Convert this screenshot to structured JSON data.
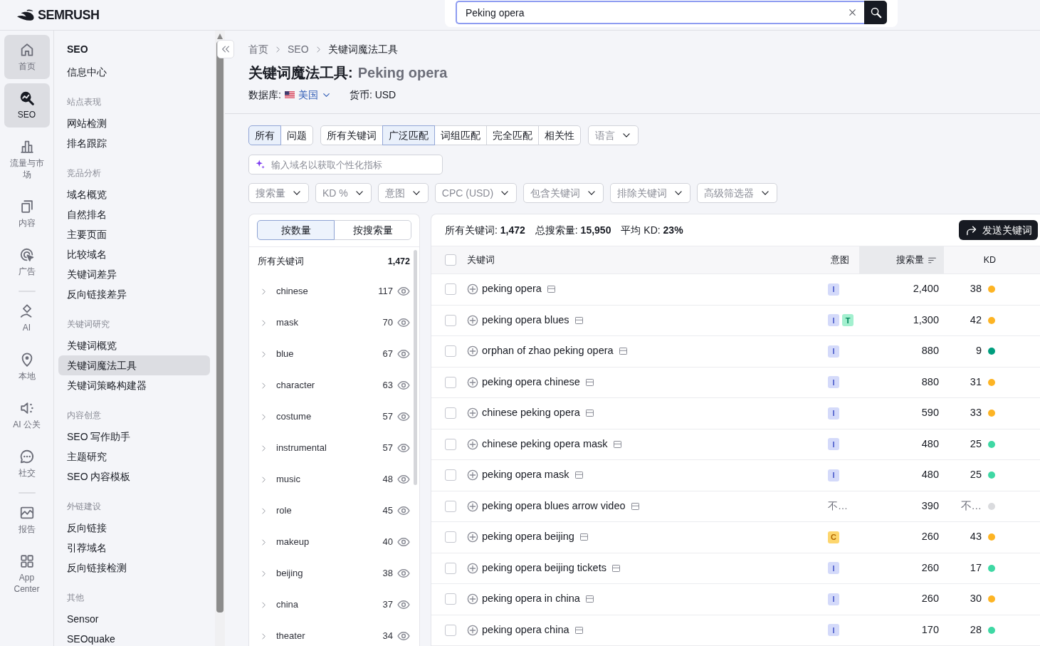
{
  "logo": {
    "text": "SEMRUSH"
  },
  "search": {
    "value": "Peking opera"
  },
  "rail": {
    "groups": [
      [
        {
          "label": "首页",
          "selected": false,
          "highlighted": true
        },
        {
          "label": "SEO",
          "selected": true,
          "highlighted": false
        },
        {
          "label": "流量与市场",
          "selected": false,
          "highlighted": false
        },
        {
          "label": "内容",
          "selected": false,
          "highlighted": false
        },
        {
          "label": "广告",
          "selected": false,
          "highlighted": false
        }
      ],
      [
        {
          "label": "AI",
          "selected": false,
          "highlighted": false
        },
        {
          "label": "本地",
          "selected": false,
          "highlighted": false
        },
        {
          "label": "AI 公关",
          "selected": false,
          "highlighted": false
        },
        {
          "label": "社交",
          "selected": false,
          "highlighted": false
        }
      ],
      [
        {
          "label": "报告",
          "selected": false,
          "highlighted": false
        },
        {
          "label": "App Center",
          "selected": false,
          "highlighted": false
        }
      ]
    ]
  },
  "menu": {
    "title": "SEO",
    "items": [
      {
        "label": "信息中心",
        "selected": false
      }
    ],
    "sections": [
      {
        "heading": "站点表现",
        "items": [
          {
            "label": "网站检测",
            "selected": false
          },
          {
            "label": "排名跟踪",
            "selected": false
          }
        ]
      },
      {
        "heading": "竞品分析",
        "items": [
          {
            "label": "域名概览",
            "selected": false
          },
          {
            "label": "自然排名",
            "selected": false
          },
          {
            "label": "主要页面",
            "selected": false
          },
          {
            "label": "比较域名",
            "selected": false
          },
          {
            "label": "关键词差异",
            "selected": false
          },
          {
            "label": "反向链接差异",
            "selected": false
          }
        ]
      },
      {
        "heading": "关键词研究",
        "items": [
          {
            "label": "关键词概览",
            "selected": false
          },
          {
            "label": "关键词魔法工具",
            "selected": true
          },
          {
            "label": "关键词策略构建器",
            "selected": false
          }
        ]
      },
      {
        "heading": "内容创意",
        "items": [
          {
            "label": "SEO 写作助手",
            "selected": false
          },
          {
            "label": "主题研究",
            "selected": false
          },
          {
            "label": "SEO 内容模板",
            "selected": false
          }
        ]
      },
      {
        "heading": "外链建设",
        "items": [
          {
            "label": "反向链接",
            "selected": false
          },
          {
            "label": "引荐域名",
            "selected": false
          },
          {
            "label": "反向链接检测",
            "selected": false
          }
        ]
      },
      {
        "heading": "其他",
        "items": [
          {
            "label": "Sensor",
            "selected": false
          },
          {
            "label": "SEOquake",
            "selected": false
          }
        ]
      }
    ]
  },
  "breadcrumbs": [
    {
      "label": "首页"
    },
    {
      "label": "SEO"
    },
    {
      "label": "关键词魔法工具"
    }
  ],
  "title": {
    "tool": "关键词魔法工具:",
    "query": "Peking opera"
  },
  "database": {
    "label": "数据库:",
    "value": "美国"
  },
  "currency": "货币: USD",
  "match_filters": [
    [
      {
        "label": "所有",
        "selected": true
      },
      {
        "label": "问题",
        "selected": false
      }
    ],
    [
      {
        "label": "所有关键词",
        "selected": false
      },
      {
        "label": "广泛匹配",
        "selected": true
      },
      {
        "label": "词组匹配",
        "selected": false
      },
      {
        "label": "完全匹配",
        "selected": false
      },
      {
        "label": "相关性",
        "selected": false
      }
    ]
  ],
  "language": {
    "placeholder": "语言"
  },
  "domain_input": {
    "placeholder": "输入域名以获取个性化指标"
  },
  "filters": [
    "搜索量",
    "KD %",
    "意图",
    "CPC (USD)",
    "包含关键词",
    "排除关键词",
    "高级筛选器"
  ],
  "groups_panel": {
    "toggle": [
      {
        "label": "按数量",
        "selected": true
      },
      {
        "label": "按搜索量",
        "selected": false
      }
    ],
    "total": {
      "label": "所有关键词",
      "count": "1,472"
    },
    "items": [
      {
        "label": "chinese",
        "count": "117",
        "expanded": false
      },
      {
        "label": "mask",
        "count": "70",
        "expanded": false
      },
      {
        "label": "blue",
        "count": "67",
        "expanded": false
      },
      {
        "label": "character",
        "count": "63",
        "expanded": false
      },
      {
        "label": "costume",
        "count": "57",
        "expanded": false
      },
      {
        "label": "instrumental",
        "count": "57",
        "expanded": false
      },
      {
        "label": "music",
        "count": "48",
        "expanded": false
      },
      {
        "label": "role",
        "count": "45",
        "expanded": false
      },
      {
        "label": "makeup",
        "count": "40",
        "expanded": false
      },
      {
        "label": "beijing",
        "count": "38",
        "expanded": false
      },
      {
        "label": "china",
        "count": "37",
        "expanded": false
      },
      {
        "label": "theater",
        "count": "34",
        "expanded": false
      }
    ]
  },
  "results": {
    "stats": [
      "所有关键词: **1,472**",
      "总搜索量: **15,950**",
      "平均 KD: **23%**"
    ],
    "send_button": "发送关键词",
    "select_all_checked": false,
    "columns": [
      {
        "label": "关键词",
        "sorted": false
      },
      {
        "label": "意图",
        "sorted": false
      },
      {
        "label": "搜索量",
        "sorted": true
      },
      {
        "label": "KD",
        "sorted": false
      }
    ],
    "rows": [
      {
        "keyword": "peking opera",
        "checked": false,
        "intents": [
          {
            "label": "I",
            "kind": "informational"
          }
        ],
        "volume": "2,400",
        "kd": {
          "value": "38",
          "color": "#fdb424"
        }
      },
      {
        "keyword": "peking opera blues",
        "checked": false,
        "intents": [
          {
            "label": "I",
            "kind": "informational"
          },
          {
            "label": "T",
            "kind": "transactional"
          }
        ],
        "volume": "1,300",
        "kd": {
          "value": "42",
          "color": "#fdb424"
        }
      },
      {
        "keyword": "orphan of zhao peking opera",
        "checked": false,
        "intents": [
          {
            "label": "I",
            "kind": "informational"
          }
        ],
        "volume": "880",
        "kd": {
          "value": "9",
          "color": "#009e7e"
        }
      },
      {
        "keyword": "peking opera chinese",
        "checked": false,
        "intents": [
          {
            "label": "I",
            "kind": "informational"
          }
        ],
        "volume": "880",
        "kd": {
          "value": "31",
          "color": "#fdb424"
        }
      },
      {
        "keyword": "chinese peking opera",
        "checked": false,
        "intents": [
          {
            "label": "I",
            "kind": "informational"
          }
        ],
        "volume": "590",
        "kd": {
          "value": "33",
          "color": "#fdb424"
        }
      },
      {
        "keyword": "chinese peking opera mask",
        "checked": false,
        "intents": [
          {
            "label": "I",
            "kind": "informational"
          }
        ],
        "volume": "480",
        "kd": {
          "value": "25",
          "color": "#3fd8a4"
        }
      },
      {
        "keyword": "peking opera mask",
        "checked": false,
        "intents": [
          {
            "label": "I",
            "kind": "informational"
          }
        ],
        "volume": "480",
        "kd": {
          "value": "25",
          "color": "#3fd8a4"
        }
      },
      {
        "keyword": "peking opera blues arrow video",
        "checked": false,
        "intent_text": "不…",
        "volume": "390",
        "kd": {
          "value": "不…",
          "color": "#dadbde"
        }
      },
      {
        "keyword": "peking opera beijing",
        "checked": false,
        "intents": [
          {
            "label": "C",
            "kind": "commercial"
          }
        ],
        "volume": "260",
        "kd": {
          "value": "43",
          "color": "#fdb424"
        }
      },
      {
        "keyword": "peking opera beijing tickets",
        "checked": false,
        "intents": [
          {
            "label": "I",
            "kind": "informational"
          }
        ],
        "volume": "260",
        "kd": {
          "value": "17",
          "color": "#3fd8a4"
        }
      },
      {
        "keyword": "peking opera in china",
        "checked": false,
        "intents": [
          {
            "label": "I",
            "kind": "informational"
          }
        ],
        "volume": "260",
        "kd": {
          "value": "30",
          "color": "#fdb424"
        }
      },
      {
        "keyword": "peking opera china",
        "checked": false,
        "intents": [
          {
            "label": "I",
            "kind": "informational"
          }
        ],
        "volume": "170",
        "kd": {
          "value": "28",
          "color": "#3fd8a4"
        }
      }
    ]
  }
}
